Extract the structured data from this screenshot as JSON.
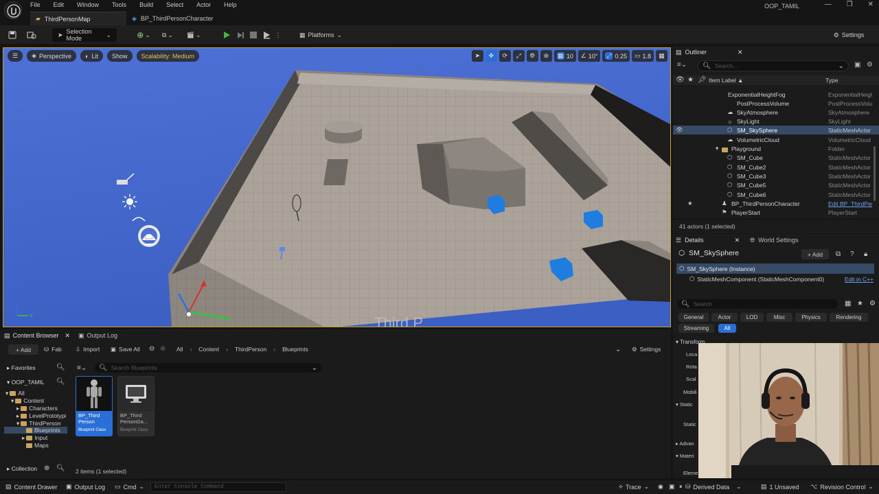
{
  "menubar": {
    "items": [
      "File",
      "Edit",
      "Window",
      "Tools",
      "Build",
      "Select",
      "Actor",
      "Help"
    ],
    "project_name": "OOP_TAMIL"
  },
  "doc_tabs": [
    "ThirdPersonMap",
    "BP_ThirdPersonCharacter"
  ],
  "toolbar": {
    "selection_mode": "Selection Mode",
    "platforms": "Platforms",
    "settings": "Settings"
  },
  "viewport": {
    "perspective": "Perspective",
    "lit": "Lit",
    "show": "Show",
    "scalability": "Scalability: Medium",
    "grid_snap": "10",
    "rot_snap": "10°",
    "scale_snap": "0.25",
    "cam_speed": "1.8",
    "floor_text": "Third P"
  },
  "outliner": {
    "tab": "Outliner",
    "search_placeholder": "Search...",
    "col_label": "Item Label ▲",
    "col_type": "Type",
    "rows": [
      {
        "label": "ExponentialHeightFog",
        "type": "ExponentialHeigh"
      },
      {
        "label": "PostProcessVolume",
        "type": "PostProcessVolu"
      },
      {
        "label": "SkyAtmosphere",
        "type": "SkyAtmosphere"
      },
      {
        "label": "SkyLight",
        "type": "SkyLight"
      },
      {
        "label": "SM_SkySphere",
        "type": "StaticMeshActor"
      },
      {
        "label": "VolumetricCloud",
        "type": "VolumetricCloud"
      },
      {
        "label": "Playground",
        "type": "Folder"
      },
      {
        "label": "SM_Cube",
        "type": "StaticMeshActor"
      },
      {
        "label": "SM_Cube2",
        "type": "StaticMeshActor"
      },
      {
        "label": "SM_Cube3",
        "type": "StaticMeshActor"
      },
      {
        "label": "SM_Cube5",
        "type": "StaticMeshActor"
      },
      {
        "label": "SM_Cube6",
        "type": "StaticMeshActor"
      },
      {
        "label": "BP_ThirdPersonCharacter",
        "type": "Edit BP_ThirdPer"
      },
      {
        "label": "PlayerStart",
        "type": "PlayerStart"
      }
    ],
    "footer": "41 actors (1 selected)"
  },
  "details": {
    "tab": "Details",
    "world_tab": "World Settings",
    "title": "SM_SkySphere",
    "add": "+ Add",
    "instance": "SM_SkySphere (Instance)",
    "component": "StaticMeshComponent (StaticMeshComponent0)",
    "edit_cpp": "Edit in C++",
    "search_placeholder": "Search",
    "categories": [
      "General",
      "Actor",
      "LOD",
      "Misc",
      "Physics",
      "Rendering",
      "Streaming",
      "All"
    ],
    "sections": [
      "Transform",
      "Loca",
      "Rota",
      "Scal",
      "Mobili",
      "Static",
      "Static",
      "Advan",
      "Materi",
      "Eleme"
    ]
  },
  "content_browser": {
    "tab": "Content Browser",
    "output_tab": "Output Log",
    "add": "+ Add",
    "fab": "Fab",
    "import": "Import",
    "save_all": "Save All",
    "path": [
      "All",
      "Content",
      "ThirdPerson",
      "Blueprints"
    ],
    "settings": "Settings",
    "search_placeholder": "Search Blueprints",
    "favorites": "Favorites",
    "project": "OOP_TAMIL",
    "tree": [
      "All",
      "Content",
      "Characters",
      "LevelPrototypi",
      "ThirdPerson",
      "Blueprints",
      "Input",
      "Maps"
    ],
    "collection": "Collection",
    "assets": [
      {
        "name1": "BP_Third",
        "name2": "Person",
        "kind": "Blueprint Class"
      },
      {
        "name1": "BP_Third",
        "name2": "PersonGa...",
        "kind": "Blueprint Class"
      }
    ],
    "count": "2 items (1 selected)"
  },
  "statusbar": {
    "content_drawer": "Content Drawer",
    "output_log": "Output Log",
    "cmd": "Cmd",
    "console_placeholder": "Enter Console Command",
    "trace": "Trace",
    "derived_data": "Derived Data",
    "unsaved": "1 Unsaved",
    "revision_control": "Revision Control"
  },
  "colors": {
    "accent": "#2a6fd8",
    "viewport_border": "#c9a227",
    "play_green": "#3bbd3b",
    "sky_blue": "#4a6fd1"
  }
}
